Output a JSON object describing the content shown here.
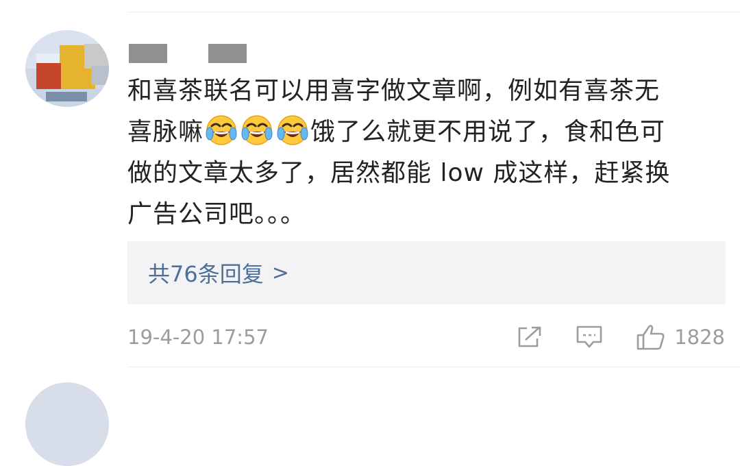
{
  "comment": {
    "username_masked": "",
    "text_line1": "和喜茶联名可以用喜字做文章啊，例如有喜茶无",
    "text_line2_pre": "喜脉嘛",
    "emoji": [
      "laughing-tears-emoji",
      "laughing-tears-emoji",
      "laughing-tears-emoji"
    ],
    "text_line2_post": "饿了么就更不用说了，食和色可",
    "text_line3": "做的文章太多了，居然都能 low 成这样，赶紧换",
    "text_line4": "广告公司吧。。。",
    "replies_label": "共76条回复",
    "replies_chevron": ">",
    "timestamp": "19-4-20 17:57",
    "like_count": "1828"
  },
  "icons": {
    "share": "share-icon",
    "comment": "comment-icon",
    "like": "thumbs-up-icon"
  },
  "colors": {
    "text": "#222222",
    "link": "#4d6f98",
    "meta": "#9c9c9c",
    "reply_bg": "#f3f3f5"
  }
}
